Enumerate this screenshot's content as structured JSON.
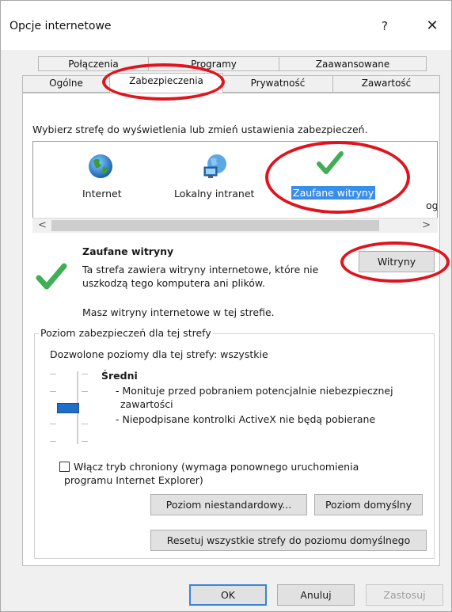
{
  "dialog": {
    "title": "Opcje internetowe",
    "help_label": "?",
    "close_label": "✕"
  },
  "tabs": {
    "row1": [
      "Połączenia",
      "Programy",
      "Zaawansowane"
    ],
    "row2": [
      "Ogólne",
      "Zabezpieczenia",
      "Prywatność",
      "Zawartość"
    ],
    "active": "Zabezpieczenia"
  },
  "security": {
    "instruction": "Wybierz strefę do wyświetlenia lub zmień ustawienia zabezpieczeń.",
    "zones": [
      {
        "label": "Internet",
        "icon": "globe-icon"
      },
      {
        "label": "Lokalny intranet",
        "icon": "intranet-icon"
      },
      {
        "label": "Zaufane witryny",
        "icon": "checkmark-icon",
        "selected": true
      },
      {
        "label": "og",
        "icon": "restricted-icon"
      }
    ],
    "scroll_left": "<",
    "scroll_right": ">",
    "zone_title": "Zaufane witryny",
    "zone_desc_line1": "Ta strefa zawiera witryny internetowe, które nie",
    "zone_desc_line2": "uszkodzą tego komputera ani plików.",
    "zone_sites_note": "Masz witryny internetowe w tej strefie.",
    "sites_button": "Witryny",
    "group_title": "Poziom zabezpieczeń dla tej strefy",
    "allowed_levels": "Dozwolone poziomy dla tej strefy: wszystkie",
    "level_name": "Średni",
    "level_desc_1": "- Monituje przed pobraniem potencjalnie niebezpiecznej",
    "level_desc_1b": "zawartości",
    "level_desc_2": "- Niepodpisane kontrolki ActiveX nie będą pobierane",
    "protected_mode_line1": "Włącz tryb chroniony (wymaga ponownego uruchomienia",
    "protected_mode_line2": "programu Internet Explorer)",
    "protected_mode_checked": false,
    "custom_level_button": "Poziom niestandardowy...",
    "default_level_button": "Poziom domyślny",
    "reset_all_button": "Resetuj wszystkie strefy do poziomu domyślnego"
  },
  "footer": {
    "ok": "OK",
    "cancel": "Anuluj",
    "apply": "Zastosuj"
  },
  "colors": {
    "highlight": "#3a8ee8",
    "annotation_red": "#e0141e",
    "check_green": "#3fae54",
    "slider_thumb": "#1e6fc8"
  }
}
